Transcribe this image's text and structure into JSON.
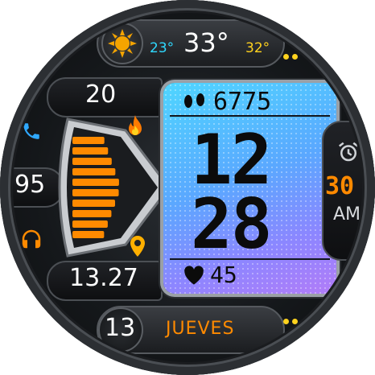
{
  "weather": {
    "current_temp": "33°",
    "low_temp": "23°",
    "high_temp": "32°",
    "icon": "sun-icon"
  },
  "left": {
    "top_value": "20",
    "middle_value": "95",
    "bottom_value": "13.27",
    "icons": [
      "phone-icon",
      "flame-icon",
      "bolt-icon",
      "headphones-icon",
      "location-pin-icon"
    ],
    "gauge_fraction": 0.95
  },
  "screen": {
    "steps": "6775",
    "hour": "12",
    "minute": "28",
    "heart_rate": "45"
  },
  "right": {
    "seconds": "30",
    "ampm": "AM",
    "icon": "alarm-clock-icon"
  },
  "date": {
    "day": "13",
    "weekday": "JUEVES"
  },
  "colors": {
    "accent_orange": "#ff8a00",
    "cyan": "#2fd9ff",
    "yellow": "#ffd21e"
  }
}
